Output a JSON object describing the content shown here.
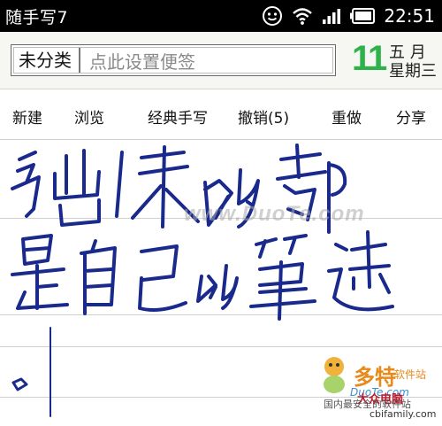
{
  "status_bar": {
    "app_title": "随手写7",
    "time": "22:51",
    "icons": [
      "smiley-icon",
      "wifi-icon",
      "signal-icon",
      "battery-icon"
    ]
  },
  "header": {
    "category": "未分类",
    "note_placeholder": "点此设置便签",
    "date_day": "11",
    "date_month": "五 月",
    "date_weekday": "星期三"
  },
  "toolbar": {
    "new_label": "新建",
    "browse_label": "浏览",
    "mode_label": "经典手写",
    "undo_label": "撤销(5)",
    "redo_label": "重做",
    "share_label": "分享"
  },
  "canvas": {
    "handwriting": [
      "写出来的都",
      "是自己的笔迹"
    ]
  },
  "watermark": {
    "site": "www.DuoTe.com",
    "logo_name": "多特",
    "logo_suffix": "软件站",
    "logo_url": "DuoTe.com",
    "logo_tagline": "国内最安全的软件站",
    "brand": "大众电脑",
    "brand_url": "cbifamily.com"
  },
  "colors": {
    "accent_green": "#2db34a",
    "ink_blue": "#1a2a8c",
    "status_bar": "#000000"
  }
}
